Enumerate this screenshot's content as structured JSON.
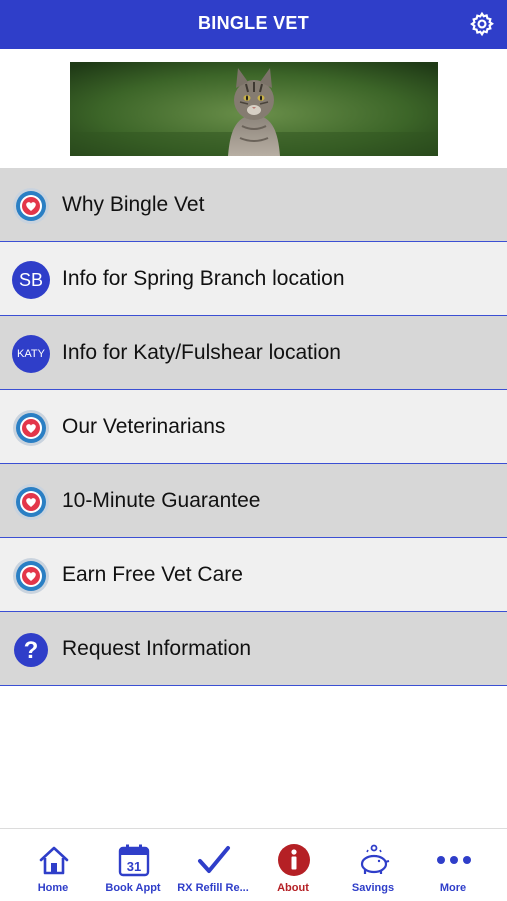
{
  "header": {
    "title": "BINGLE VET"
  },
  "menu": {
    "items": [
      {
        "label": "Why Bingle Vet",
        "icon": "heart-badge-icon"
      },
      {
        "label": "Info for Spring Branch location",
        "icon": "sb-badge-icon",
        "badge_text": "SB"
      },
      {
        "label": "Info for Katy/Fulshear location",
        "icon": "katy-badge-icon",
        "badge_text": "KATY"
      },
      {
        "label": "Our Veterinarians",
        "icon": "heart-badge-icon"
      },
      {
        "label": "10-Minute Guarantee",
        "icon": "heart-badge-icon"
      },
      {
        "label": "Earn Free Vet Care",
        "icon": "heart-badge-icon"
      },
      {
        "label": "Request Information",
        "icon": "question-icon"
      }
    ]
  },
  "tabbar": {
    "tabs": [
      {
        "label": "Home",
        "icon": "home-icon"
      },
      {
        "label": "Book Appt",
        "icon": "calendar-icon",
        "icon_text": "31"
      },
      {
        "label": "RX Refill Re...",
        "icon": "checkmark-icon"
      },
      {
        "label": "About",
        "icon": "info-icon"
      },
      {
        "label": "Savings",
        "icon": "piggy-bank-icon"
      },
      {
        "label": "More",
        "icon": "more-dots-icon"
      }
    ]
  },
  "colors": {
    "brand_blue": "#2f3ec9",
    "about_red": "#b52025",
    "row_dark": "#d7d7d7",
    "row_light": "#f0f0f0",
    "divider": "#3b4fd3"
  }
}
